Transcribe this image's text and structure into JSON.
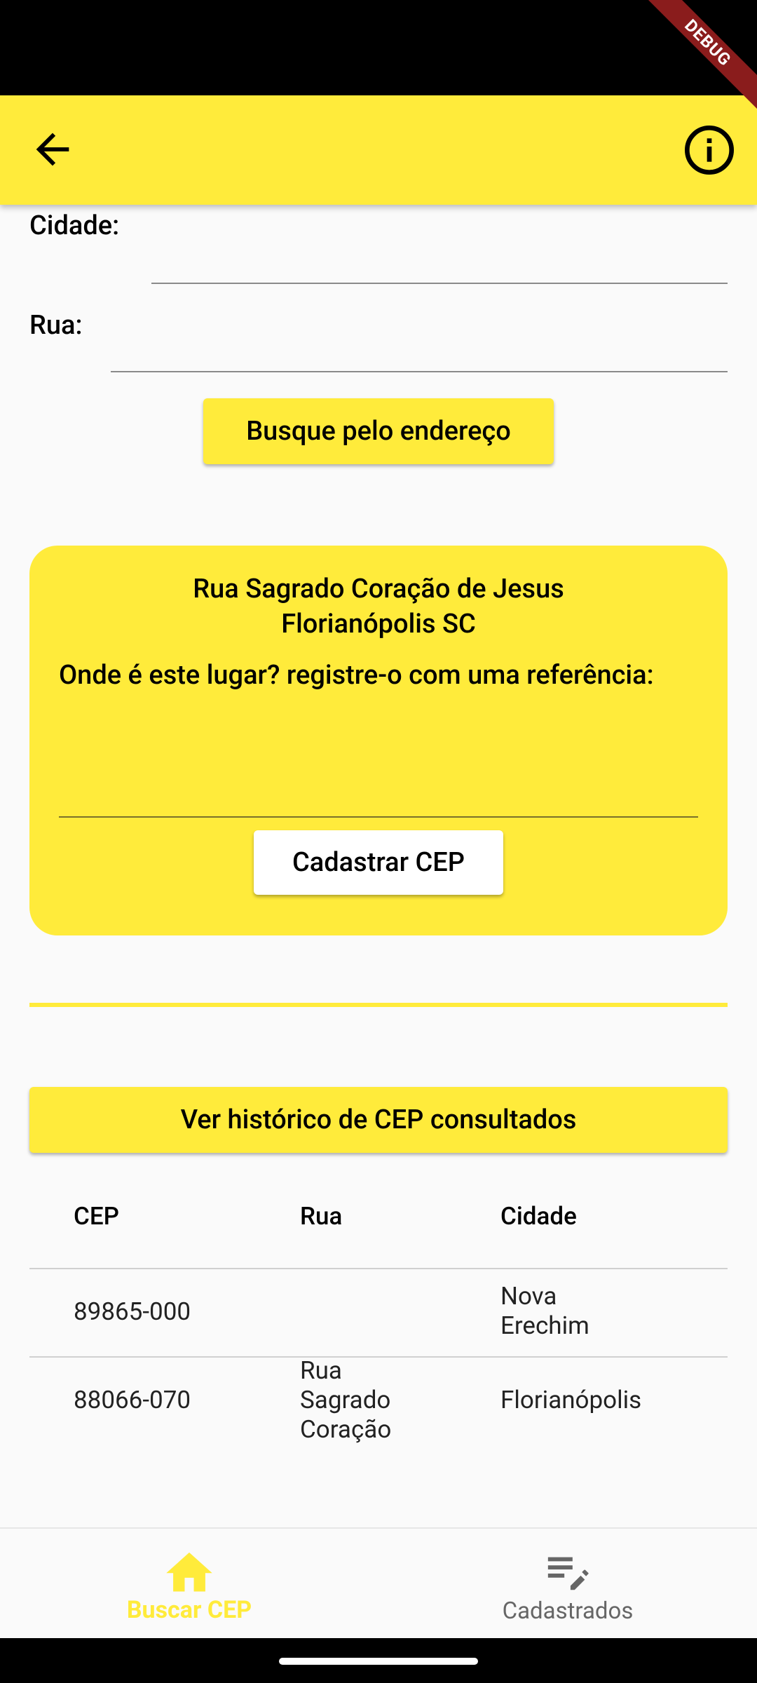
{
  "colors": {
    "accent": "#ffeb3b",
    "inactive": "#666666"
  },
  "debug_label": "DEBUG",
  "appbar": {
    "back_icon": "arrow-back-icon",
    "info_icon": "info-icon"
  },
  "form": {
    "cidade_label": "Cidade:",
    "rua_label": "Rua:",
    "search_button": "Busque pelo endereço"
  },
  "result_card": {
    "street": "Rua Sagrado Coração de Jesus",
    "city_state": "Florianópolis  SC",
    "prompt": "Onde é este lugar? registre-o com uma referência:",
    "reference_value": "",
    "register_button": "Cadastrar CEP"
  },
  "history_button": "Ver histórico de CEP consultados",
  "table": {
    "headers": [
      "CEP",
      "Rua",
      "Cidade"
    ],
    "rows": [
      {
        "cep": "89865-000",
        "rua": "",
        "cidade": "Nova Erechim"
      },
      {
        "cep": "88066-070",
        "rua": "Rua Sagrado Coração",
        "cidade": "Florianópolis"
      }
    ]
  },
  "bottom_nav": {
    "items": [
      {
        "label": "Buscar CEP",
        "icon": "home-icon",
        "active": true
      },
      {
        "label": "Cadastrados",
        "icon": "edit-list-icon",
        "active": false
      }
    ]
  }
}
